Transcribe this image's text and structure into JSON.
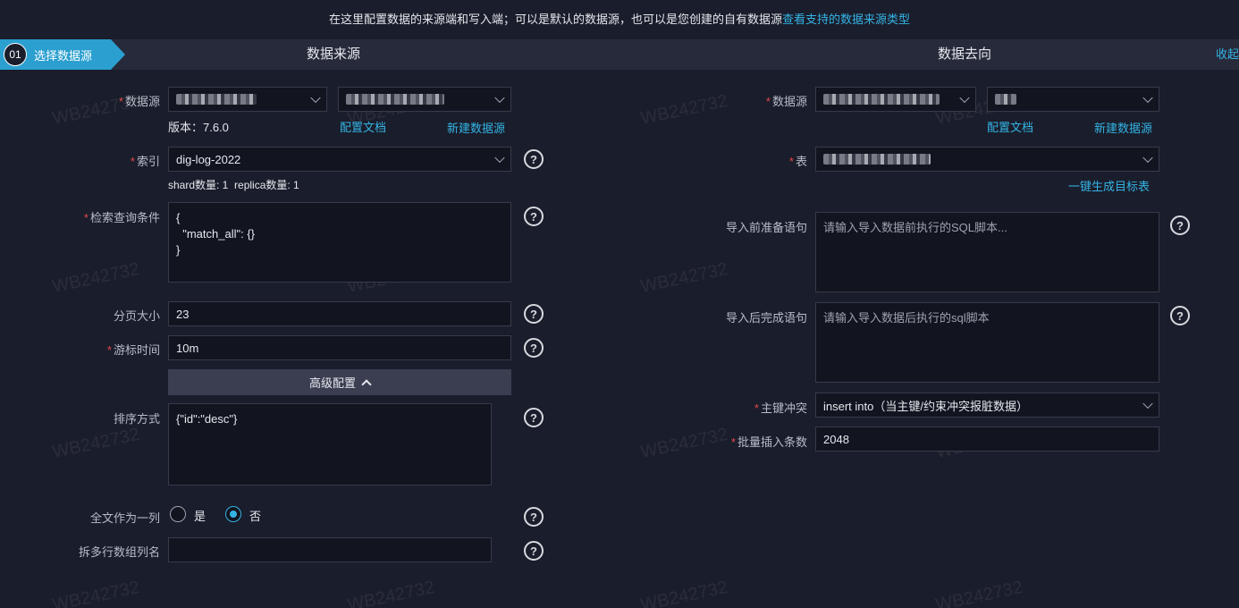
{
  "notice": {
    "text": "在这里配置数据的来源端和写入端；可以是默认的数据源，也可以是您创建的自有数据源",
    "link": "查看支持的数据来源类型"
  },
  "steps": {
    "number": "01",
    "active_label": "选择数据源",
    "source_title": "数据来源",
    "target_title": "数据去向",
    "collapse": "收起"
  },
  "source": {
    "datasource_label": "数据源",
    "version": "版本：7.6.0",
    "config_doc": "配置文档",
    "new_datasource": "新建数据源",
    "index_label": "索引",
    "index_value": "dig-log-2022",
    "shard_info": "shard数量: 1  replica数量: 1",
    "query_label": "检索查询条件",
    "query_value": "{\n  \"match_all\": {}\n}",
    "page_size_label": "分页大小",
    "page_size_value": "23",
    "cursor_label": "游标时间",
    "cursor_value": "10m",
    "advanced": "高级配置",
    "sort_label": "排序方式",
    "sort_value": "{\"id\":\"desc\"}",
    "fulltext_label": "全文作为一列",
    "opt_yes": "是",
    "opt_no": "否",
    "split_label": "拆多行数组列名"
  },
  "target": {
    "datasource_label": "数据源",
    "config_doc": "配置文档",
    "new_datasource": "新建数据源",
    "table_label": "表",
    "gen_table": "一键生成目标表",
    "pre_label": "导入前准备语句",
    "pre_placeholder": "请输入导入数据前执行的SQL脚本...",
    "post_label": "导入后完成语句",
    "post_placeholder": "请输入导入数据后执行的sql脚本",
    "pk_label": "主键冲突",
    "pk_value": "insert into（当主键/约束冲突报脏数据）",
    "batch_label": "批量插入条数",
    "batch_value": "2048"
  },
  "watermark": "WB242732",
  "colors": {
    "accent": "#2a9fd0",
    "link": "#34b3e4",
    "required": "#e5484d",
    "background": "#1a1d2b"
  }
}
